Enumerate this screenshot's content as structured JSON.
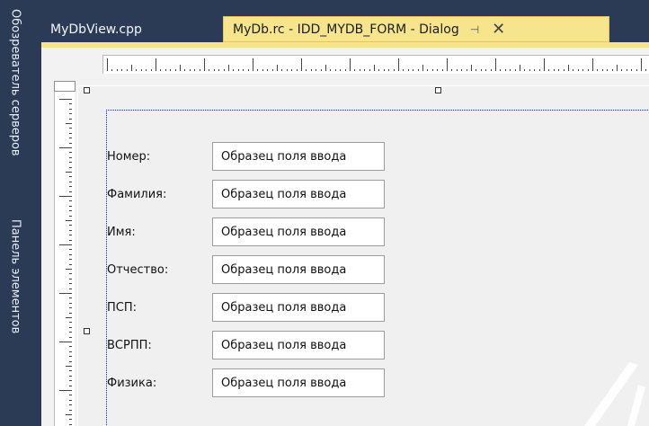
{
  "side_panel": {
    "servers_tab": "Обозреватель серверов",
    "toolbox_tab": "Панель элементов"
  },
  "tabs": {
    "inactive": "MyDbView.cpp",
    "active": "MyDb.rc - IDD_MYDB_FORM - Dialog",
    "pin_glyph": "⊣",
    "close_glyph": "✕"
  },
  "form": {
    "fields": [
      {
        "label": "Номер:",
        "value": "Образец поля ввода"
      },
      {
        "label": "Фамилия:",
        "value": "Образец поля ввода"
      },
      {
        "label": "Имя:",
        "value": "Образец поля ввода"
      },
      {
        "label": "Отчество:",
        "value": "Образец поля ввода"
      },
      {
        "label": "ПСП:",
        "value": "Образец поля ввода"
      },
      {
        "label": "ВСРПП:",
        "value": "Образец поля ввода"
      },
      {
        "label": "Физика:",
        "value": "Образец поля ввода"
      }
    ]
  },
  "colors": {
    "panel_bg": "#2b3a55",
    "active_tab": "#f7e58d",
    "editor_bg": "#f2f2f2",
    "dialog_border": "#0a2c9e"
  },
  "icons": [
    "pin-icon",
    "close-icon"
  ]
}
